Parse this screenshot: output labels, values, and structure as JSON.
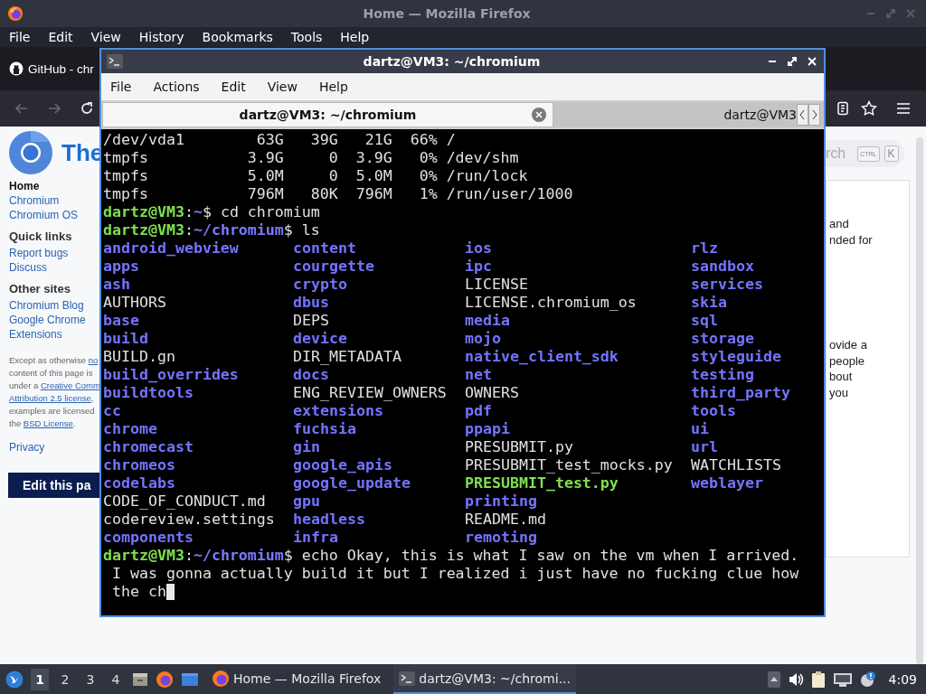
{
  "firefox": {
    "title": "Home — Mozilla Firefox",
    "menu": [
      "File",
      "Edit",
      "View",
      "History",
      "Bookmarks",
      "Tools",
      "Help"
    ],
    "tab": {
      "title": "GitHub - chr"
    },
    "page": {
      "heading": "The",
      "nav": [
        {
          "heading": "Home",
          "links": [
            "Chromium",
            "Chromium OS"
          ]
        },
        {
          "heading": "Quick links",
          "links": [
            "Report bugs",
            "Discuss"
          ]
        },
        {
          "heading": "Other sites",
          "links": [
            "Chromium Blog",
            "Google Chrome",
            "Extensions"
          ]
        }
      ],
      "footer": [
        [
          {
            "text": "Except as otherwise "
          },
          {
            "text": "no",
            "link": true
          }
        ],
        [
          {
            "text": "content of this page is"
          }
        ],
        [
          {
            "text": "under a "
          },
          {
            "text": "Creative Comm",
            "link": true
          }
        ],
        [
          {
            "text": "Attribution 2.5 license",
            "link": true
          },
          {
            "text": ","
          }
        ],
        [
          {
            "text": "examples are licensed"
          }
        ],
        [
          {
            "text": "the "
          },
          {
            "text": "BSD License",
            "link": true
          },
          {
            "text": "."
          }
        ]
      ],
      "privacy": "Privacy",
      "edit_button": "Edit this pa",
      "search": {
        "placeholder": "rch",
        "keys": [
          "CTRL",
          "K"
        ]
      },
      "fragments": [
        [
          "and",
          "nded for"
        ],
        [
          "ovide a",
          "people",
          "bout",
          "you"
        ]
      ]
    }
  },
  "terminal": {
    "title": "dartz@VM3: ~/chromium",
    "menu": [
      "File",
      "Actions",
      "Edit",
      "View",
      "Help"
    ],
    "tabs": [
      {
        "label": "dartz@VM3: ~/chromium",
        "selected": true
      },
      {
        "label": "dartz@VM3",
        "selected": false
      }
    ],
    "lines": [
      {
        "kind": "text",
        "text": "/dev/vda1        63G   39G   21G  66% /"
      },
      {
        "kind": "text",
        "text": "tmpfs           3.9G     0  3.9G   0% /dev/shm"
      },
      {
        "kind": "text",
        "text": "tmpfs           5.0M     0  5.0M   0% /run/lock"
      },
      {
        "kind": "text",
        "text": "tmpfs           796M   80K  796M   1% /run/user/1000"
      },
      {
        "kind": "prompt",
        "user": "dartz@VM3",
        "separator": ":",
        "path": "~",
        "command": "$ cd chromium"
      },
      {
        "kind": "prompt",
        "user": "dartz@VM3",
        "separator": ":",
        "path": "~/chromium",
        "command": "$ ls"
      },
      {
        "kind": "ls",
        "rows": [
          [
            {
              "name": "android_webview",
              "kind": "dir"
            },
            {
              "name": "content",
              "kind": "dir"
            },
            {
              "name": "ios",
              "kind": "dir"
            },
            {
              "name": "rlz",
              "kind": "dir"
            }
          ],
          [
            {
              "name": "apps",
              "kind": "dir"
            },
            {
              "name": "courgette",
              "kind": "dir"
            },
            {
              "name": "ipc",
              "kind": "dir"
            },
            {
              "name": "sandbox",
              "kind": "dir"
            }
          ],
          [
            {
              "name": "ash",
              "kind": "dir"
            },
            {
              "name": "crypto",
              "kind": "dir"
            },
            {
              "name": "LICENSE",
              "kind": "file"
            },
            {
              "name": "services",
              "kind": "dir"
            }
          ],
          [
            {
              "name": "AUTHORS",
              "kind": "file"
            },
            {
              "name": "dbus",
              "kind": "dir"
            },
            {
              "name": "LICENSE.chromium_os",
              "kind": "file"
            },
            {
              "name": "skia",
              "kind": "dir"
            }
          ],
          [
            {
              "name": "base",
              "kind": "dir"
            },
            {
              "name": "DEPS",
              "kind": "file"
            },
            {
              "name": "media",
              "kind": "dir"
            },
            {
              "name": "sql",
              "kind": "dir"
            }
          ],
          [
            {
              "name": "build",
              "kind": "dir"
            },
            {
              "name": "device",
              "kind": "dir"
            },
            {
              "name": "mojo",
              "kind": "dir"
            },
            {
              "name": "storage",
              "kind": "dir"
            }
          ],
          [
            {
              "name": "BUILD.gn",
              "kind": "file"
            },
            {
              "name": "DIR_METADATA",
              "kind": "file"
            },
            {
              "name": "native_client_sdk",
              "kind": "dir"
            },
            {
              "name": "styleguide",
              "kind": "dir"
            }
          ],
          [
            {
              "name": "build_overrides",
              "kind": "dir"
            },
            {
              "name": "docs",
              "kind": "dir"
            },
            {
              "name": "net",
              "kind": "dir"
            },
            {
              "name": "testing",
              "kind": "dir"
            }
          ],
          [
            {
              "name": "buildtools",
              "kind": "dir"
            },
            {
              "name": "ENG_REVIEW_OWNERS",
              "kind": "file"
            },
            {
              "name": "OWNERS",
              "kind": "file"
            },
            {
              "name": "third_party",
              "kind": "dir"
            }
          ],
          [
            {
              "name": "cc",
              "kind": "dir"
            },
            {
              "name": "extensions",
              "kind": "dir"
            },
            {
              "name": "pdf",
              "kind": "dir"
            },
            {
              "name": "tools",
              "kind": "dir"
            }
          ],
          [
            {
              "name": "chrome",
              "kind": "dir"
            },
            {
              "name": "fuchsia",
              "kind": "dir"
            },
            {
              "name": "ppapi",
              "kind": "dir"
            },
            {
              "name": "ui",
              "kind": "dir"
            }
          ],
          [
            {
              "name": "chromecast",
              "kind": "dir"
            },
            {
              "name": "gin",
              "kind": "dir"
            },
            {
              "name": "PRESUBMIT.py",
              "kind": "file"
            },
            {
              "name": "url",
              "kind": "dir"
            }
          ],
          [
            {
              "name": "chromeos",
              "kind": "dir"
            },
            {
              "name": "google_apis",
              "kind": "dir"
            },
            {
              "name": "PRESUBMIT_test_mocks.py",
              "kind": "file"
            },
            {
              "name": "WATCHLISTS",
              "kind": "file"
            }
          ],
          [
            {
              "name": "codelabs",
              "kind": "dir"
            },
            {
              "name": "google_update",
              "kind": "dir"
            },
            {
              "name": "PRESUBMIT_test.py",
              "kind": "exec"
            },
            {
              "name": "weblayer",
              "kind": "dir"
            }
          ],
          [
            {
              "name": "CODE_OF_CONDUCT.md",
              "kind": "file"
            },
            {
              "name": "gpu",
              "kind": "dir"
            },
            {
              "name": "printing",
              "kind": "dir"
            }
          ],
          [
            {
              "name": "codereview.settings",
              "kind": "file"
            },
            {
              "name": "headless",
              "kind": "dir"
            },
            {
              "name": "README.md",
              "kind": "file"
            }
          ],
          [
            {
              "name": "components",
              "kind": "dir"
            },
            {
              "name": "infra",
              "kind": "dir"
            },
            {
              "name": "remoting",
              "kind": "dir"
            }
          ]
        ]
      },
      {
        "kind": "prompt",
        "user": "dartz@VM3",
        "separator": ":",
        "path": "~/chromium",
        "command": "$ echo Okay, this is what I saw on the vm when I arrived."
      },
      {
        "kind": "text",
        "text": " I was gonna actually build it but I realized i just have no fucking clue how"
      },
      {
        "kind": "text",
        "text": " the ch",
        "cursor": true
      }
    ]
  },
  "taskbar": {
    "workspaces": [
      {
        "label": "1",
        "selected": true
      },
      {
        "label": "2",
        "selected": false
      },
      {
        "label": "3",
        "selected": false
      },
      {
        "label": "4",
        "selected": false
      }
    ],
    "tasks": [
      {
        "label": "Home — Mozilla Firefox",
        "kind": "firefox",
        "selected": false
      },
      {
        "label": "dartz@VM3: ~/chromi...",
        "kind": "terminal",
        "selected": true
      }
    ],
    "clock": "4:09"
  }
}
